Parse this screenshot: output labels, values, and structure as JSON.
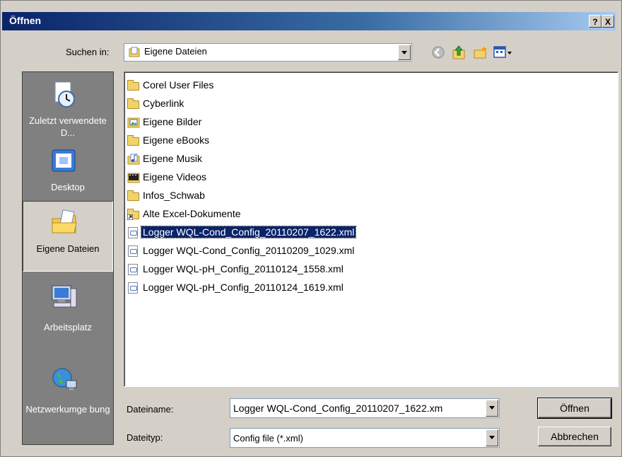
{
  "title": "Öffnen",
  "titlebar_buttons": {
    "help": "?",
    "close": "X"
  },
  "look_in": {
    "label": "Suchen in:",
    "value": "Eigene Dateien"
  },
  "toolbar": {
    "icons": [
      "back-icon",
      "up-folder-icon",
      "new-folder-icon",
      "view-menu-icon"
    ]
  },
  "places": [
    {
      "label": "Zuletzt verwendete D...",
      "icon": "recent-documents-icon"
    },
    {
      "label": "Desktop",
      "icon": "desktop-icon"
    },
    {
      "label": "Eigene Dateien",
      "icon": "my-documents-icon",
      "selected": true
    },
    {
      "label": "Arbeitsplatz",
      "icon": "my-computer-icon"
    },
    {
      "label": "Netzwerkumge bung",
      "icon": "network-icon"
    }
  ],
  "files": [
    {
      "name": "Corel User Files",
      "type": "folder"
    },
    {
      "name": "Cyberlink",
      "type": "folder"
    },
    {
      "name": "Eigene Bilder",
      "type": "pictures-folder"
    },
    {
      "name": "Eigene eBooks",
      "type": "folder"
    },
    {
      "name": "Eigene Musik",
      "type": "music-folder"
    },
    {
      "name": "Eigene Videos",
      "type": "video-folder"
    },
    {
      "name": "Infos_Schwab",
      "type": "folder"
    },
    {
      "name": "Alte Excel-Dokumente",
      "type": "folder-shortcut"
    },
    {
      "name": "Logger WQL-Cond_Config_20110207_1622.xml",
      "type": "xml",
      "selected": true
    },
    {
      "name": "Logger WQL-Cond_Config_20110209_1029.xml",
      "type": "xml"
    },
    {
      "name": "Logger WQL-pH_Config_20110124_1558.xml",
      "type": "xml"
    },
    {
      "name": "Logger WQL-pH_Config_20110124_1619.xml",
      "type": "xml"
    }
  ],
  "filename": {
    "label": "Dateiname:",
    "value": "Logger WQL-Cond_Config_20110207_1622.xm"
  },
  "filetype": {
    "label": "Dateityp:",
    "value": "Config file (*.xml)"
  },
  "buttons": {
    "open": "Öffnen",
    "cancel": "Abbrechen"
  }
}
